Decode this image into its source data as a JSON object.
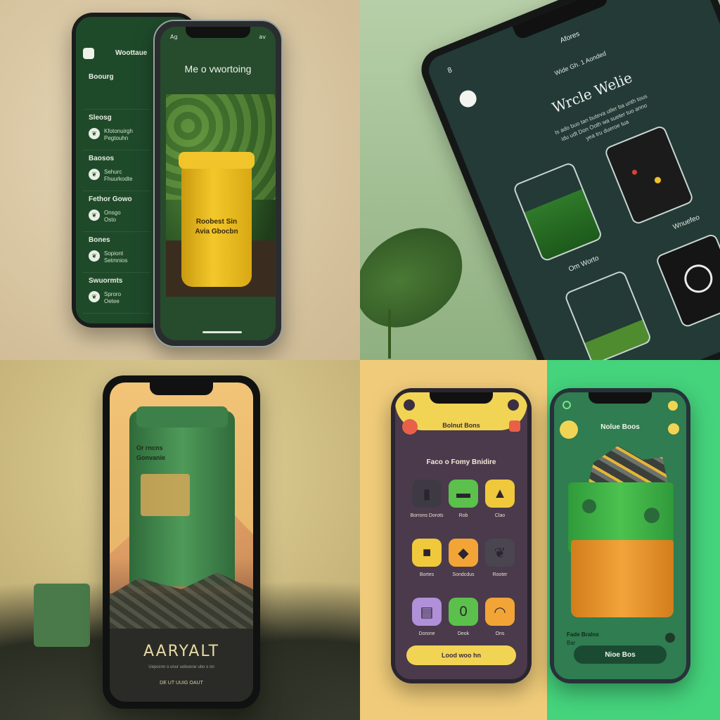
{
  "q1": {
    "back_phone": {
      "header": "Woottaue",
      "items": [
        {
          "label": "Boourg",
          "sub": ""
        },
        {
          "label": "Sleosg",
          "sub": "Kfotonuirgh\nPegtouhn"
        },
        {
          "label": "Baosos",
          "sub": "Sehurc\nFhuurkodte"
        },
        {
          "label": "Fethor Gowo",
          "sub": "Onsgo\nOsto"
        },
        {
          "label": "Bones",
          "sub": "Sopiont\nSetmnios"
        },
        {
          "label": "Swuormts",
          "sub": "Sproro\nOetee"
        }
      ]
    },
    "front_phone": {
      "status_left": "Ag",
      "status_right": "av",
      "title": "Me o vwortoing",
      "bin_label_line1": "Roobest Sin",
      "bin_label_line2": "Avia Gbocbn"
    }
  },
  "q2": {
    "status_left": "8",
    "app_title": "Afores",
    "subtitle": "Wide Gh. 1 Aonded",
    "heading": "Wrcle Welie",
    "body": "Is ado buo tan buteva utler ba unth tous\nidu udt Don Ooth wa sueter tuo anno\nyea tru dueroe tua",
    "jar_labels": [
      "Om Worto",
      "Wnuefeo"
    ],
    "colors": {
      "screen": "#233a37",
      "accent": "#7fd87a"
    }
  },
  "q3": {
    "box_text_line1": "Or rncns",
    "box_text_line2": "Gonvanie",
    "title": "AARYALT",
    "subtitle": "Uepocnn o unur uobuorar ubo o on",
    "footer": "DE UT UUIG OAUT"
  },
  "q4": {
    "left_phone": {
      "header": "Bolnut Bons",
      "heading": "Faco o Fomy Bnidire",
      "tiles": [
        {
          "icon": "bin-icon",
          "caption": "Borrons Dorots",
          "bg": "#3e3a44"
        },
        {
          "icon": "tray-icon",
          "caption": "Rob",
          "bg": "#5cc04c"
        },
        {
          "icon": "hat-icon",
          "caption": "Clao",
          "bg": "#f0c83c"
        },
        {
          "icon": "bag-icon",
          "caption": "Bortes",
          "bg": "#f0c83c"
        },
        {
          "icon": "sack-icon",
          "caption": "Sondcdus",
          "bg": "#f2a536"
        },
        {
          "icon": "leaf-icon",
          "caption": "Rooter",
          "bg": "#4a4650"
        },
        {
          "icon": "sheet-icon",
          "caption": "Dorone",
          "bg": "#b090d8"
        },
        {
          "icon": "zero-icon",
          "caption": "Deok",
          "bg": "#5cc04c"
        },
        {
          "icon": "saucer-icon",
          "caption": "Ons",
          "bg": "#f2a536"
        }
      ],
      "cta": "Lood woo hn"
    },
    "right_phone": {
      "header": "Nolue Boos",
      "caption_line1": "Fade Bralns",
      "caption_line2": "Bar",
      "cta": "Nioe Bos"
    }
  }
}
